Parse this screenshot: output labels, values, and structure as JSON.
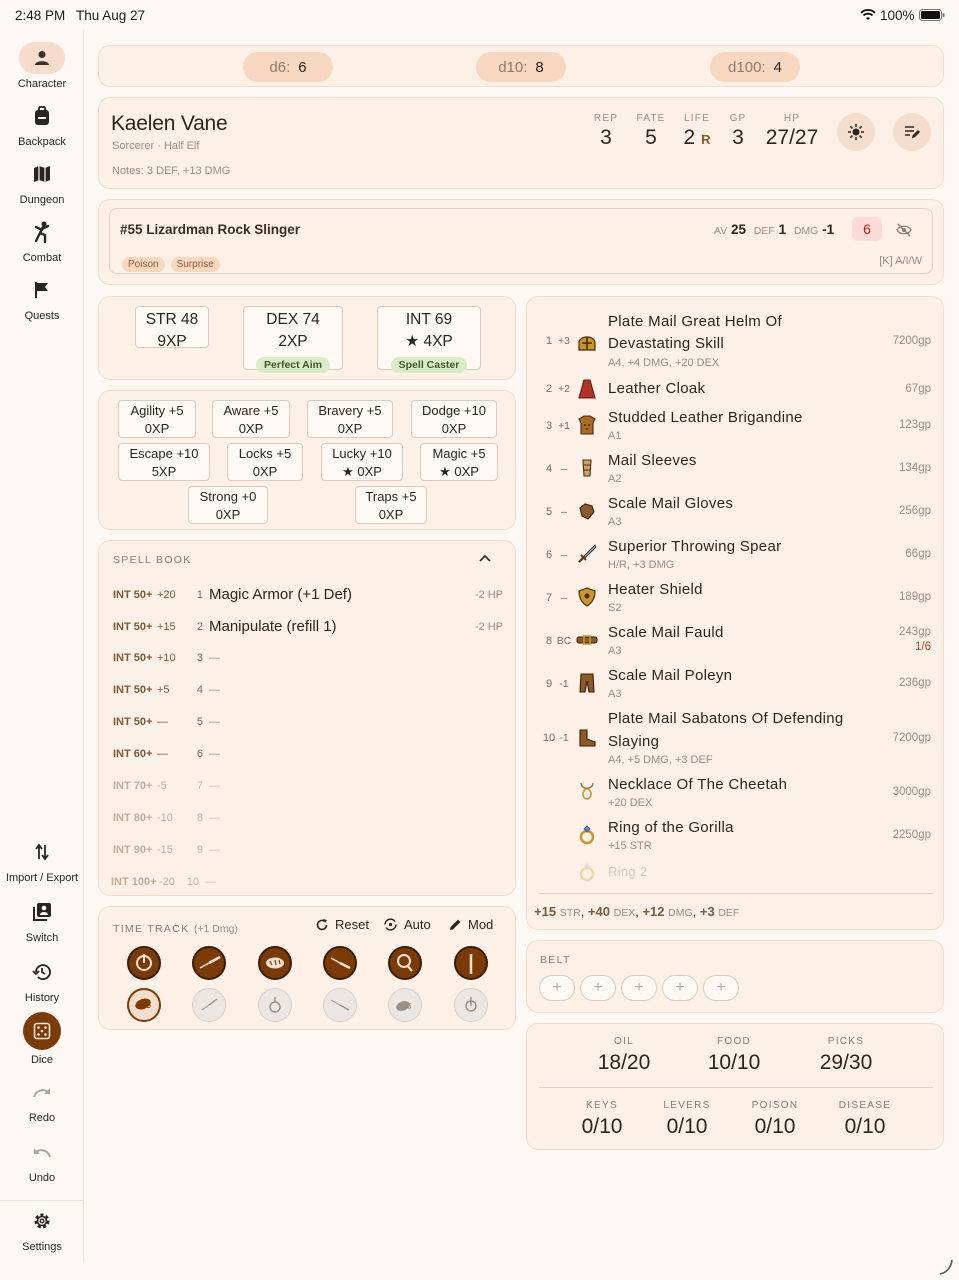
{
  "status": {
    "time": "2:48 PM",
    "date": "Thu Aug 27",
    "battery": "100%"
  },
  "nav": {
    "top": [
      {
        "label": "Character",
        "icon": "person-icon"
      },
      {
        "label": "Backpack",
        "icon": "backpack-icon"
      },
      {
        "label": "Dungeon",
        "icon": "map-icon"
      },
      {
        "label": "Combat",
        "icon": "kick-icon"
      },
      {
        "label": "Quests",
        "icon": "flag-icon"
      }
    ],
    "bottom": [
      {
        "label": "Import / Export",
        "icon": "swap-vertical-icon"
      },
      {
        "label": "Switch",
        "icon": "switch-account-icon"
      },
      {
        "label": "History",
        "icon": "history-icon"
      },
      {
        "label": "Dice",
        "icon": "dice-icon"
      },
      {
        "label": "Redo",
        "icon": "redo-icon"
      },
      {
        "label": "Undo",
        "icon": "undo-icon"
      },
      {
        "label": "Settings",
        "icon": "gear-icon"
      }
    ]
  },
  "dice": [
    {
      "label": "d6:",
      "value": "6"
    },
    {
      "label": "d10:",
      "value": "8"
    },
    {
      "label": "d100:",
      "value": "4"
    }
  ],
  "character": {
    "name": "Kaelen Vane",
    "subtitle": "Sorcerer · Half Elf",
    "notes": "Notes: 3 DEF, +13 DMG",
    "stats": [
      {
        "label": "REP",
        "value": "3"
      },
      {
        "label": "FATE",
        "value": "5"
      },
      {
        "label": "LIFE",
        "value": "2",
        "suffix": "R"
      },
      {
        "label": "GP",
        "value": "3"
      },
      {
        "label": "HP",
        "value": "27/27"
      }
    ]
  },
  "monster": {
    "title": "#55 Lizardman Rock Slinger",
    "av_label": "AV",
    "av": "25",
    "def_label": "DEF",
    "def": "1",
    "dmg_label": "DMG",
    "dmg": "-1",
    "hp": "6",
    "tags": [
      "Poison",
      "Surprise"
    ],
    "keys": "[K] A/I/W"
  },
  "attributes": [
    {
      "name": "STR 48",
      "xp": "9XP",
      "badge": ""
    },
    {
      "name": "DEX 74",
      "xp": "2XP",
      "badge": "Perfect Aim"
    },
    {
      "name": "INT 69",
      "xp": "★ 4XP",
      "badge": "Spell Caster"
    }
  ],
  "skills": [
    {
      "name": "Agility +5",
      "xp": "0XP"
    },
    {
      "name": "Aware +5",
      "xp": "0XP"
    },
    {
      "name": "Bravery +5",
      "xp": "0XP"
    },
    {
      "name": "Dodge +10",
      "xp": "0XP"
    },
    {
      "name": "Escape +10",
      "xp": "5XP"
    },
    {
      "name": "Locks +5",
      "xp": "0XP"
    },
    {
      "name": "Lucky +10",
      "xp": "★ 0XP"
    },
    {
      "name": "Magic +5",
      "xp": "★ 0XP"
    },
    {
      "name": "Strong +0",
      "xp": "0XP"
    },
    {
      "name": "Traps +5",
      "xp": "0XP"
    }
  ],
  "spellbook": {
    "title": "SPELL BOOK",
    "spells": [
      {
        "req": "INT 50+",
        "bonus": "+20",
        "num": "1",
        "name": "Magic Armor (+1 Def)",
        "cost": "-2 HP"
      },
      {
        "req": "INT 50+",
        "bonus": "+15",
        "num": "2",
        "name": "Manipulate (refill 1)",
        "cost": "-2 HP"
      },
      {
        "req": "INT 50+",
        "bonus": "+10",
        "num": "3",
        "name": "—",
        "cost": ""
      },
      {
        "req": "INT 50+",
        "bonus": "+5",
        "num": "4",
        "name": "—",
        "cost": ""
      },
      {
        "req": "INT 50+",
        "bonus": "—",
        "num": "5",
        "name": "—",
        "cost": ""
      },
      {
        "req": "INT 60+",
        "bonus": "—",
        "num": "6",
        "name": "—",
        "cost": ""
      },
      {
        "req": "INT 70+",
        "bonus": "-5",
        "num": "7",
        "name": "—",
        "cost": ""
      },
      {
        "req": "INT 80+",
        "bonus": "-10",
        "num": "8",
        "name": "—",
        "cost": ""
      },
      {
        "req": "INT 90+",
        "bonus": "-15",
        "num": "9",
        "name": "—",
        "cost": ""
      },
      {
        "req": "INT 100+",
        "bonus": "-20",
        "num": "10",
        "name": "—",
        "cost": ""
      }
    ]
  },
  "timetrack": {
    "title": "TIME TRACK",
    "subtitle": "(+1 Dmg)",
    "reset": "Reset",
    "auto": "Auto",
    "mod": "Mod"
  },
  "equipment": [
    {
      "n": "1",
      "b": "+3",
      "icon": "helmet-icon",
      "name": "Plate Mail Great Helm Of",
      "name2": "Devastating Skill",
      "sub": "A4, +4 DMG, +20 DEX",
      "gp": "7200gp",
      "gp2": ""
    },
    {
      "n": "2",
      "b": "+2",
      "icon": "cloak-icon",
      "name": "Leather Cloak",
      "name2": "",
      "sub": "",
      "gp": "67gp",
      "gp2": ""
    },
    {
      "n": "3",
      "b": "+1",
      "icon": "armor-icon",
      "name": "Studded Leather Brigandine",
      "name2": "",
      "sub": "A1",
      "gp": "123gp",
      "gp2": ""
    },
    {
      "n": "4",
      "b": "–",
      "icon": "bracer-icon",
      "name": "Mail Sleeves",
      "name2": "",
      "sub": "A2",
      "gp": "134gp",
      "gp2": ""
    },
    {
      "n": "5",
      "b": "–",
      "icon": "gauntlet-icon",
      "name": "Scale Mail Gloves",
      "name2": "",
      "sub": "A3",
      "gp": "256gp",
      "gp2": ""
    },
    {
      "n": "6",
      "b": "–",
      "icon": "sword-icon",
      "name": "Superior Throwing Spear",
      "name2": "",
      "sub": "H/R, +3 DMG",
      "gp": "66gp",
      "gp2": ""
    },
    {
      "n": "7",
      "b": "–",
      "icon": "shield-icon",
      "name": "Heater Shield",
      "name2": "",
      "sub": "S2",
      "gp": "189gp",
      "gp2": ""
    },
    {
      "n": "8",
      "b": "BC",
      "icon": "belt-icon",
      "name": "Scale Mail Fauld",
      "name2": "",
      "sub": "A3",
      "gp": "243gp",
      "gp2": "1/6"
    },
    {
      "n": "9",
      "b": "-1",
      "icon": "pants-icon",
      "name": "Scale Mail Poleyn",
      "name2": "",
      "sub": "A3",
      "gp": "236gp",
      "gp2": ""
    },
    {
      "n": "10",
      "b": "-1",
      "icon": "boot-icon",
      "name": "Plate Mail Sabatons Of Defending",
      "name2": "Slaying",
      "sub": "A4, +5 DMG, +3 DEF",
      "gp": "7200gp",
      "gp2": ""
    },
    {
      "n": "",
      "b": "",
      "icon": "necklace-icon",
      "name": "Necklace Of The Cheetah",
      "name2": "",
      "sub": "+20 DEX",
      "gp": "3000gp",
      "gp2": ""
    },
    {
      "n": "",
      "b": "",
      "icon": "ring-icon",
      "name": "Ring of the Gorilla",
      "name2": "",
      "sub": "+15 STR",
      "gp": "2250gp",
      "gp2": ""
    },
    {
      "n": "",
      "b": "",
      "icon": "ring-empty-icon",
      "name": "Ring 2",
      "name2": "",
      "sub": "",
      "gp": "",
      "gp2": ""
    }
  ],
  "equipment_totals": [
    {
      "v": "+15",
      "k": "STR"
    },
    {
      "v": "+40",
      "k": "DEX"
    },
    {
      "v": "+12",
      "k": "DMG"
    },
    {
      "v": "+3",
      "k": "DEF"
    }
  ],
  "belt": {
    "title": "BELT",
    "slot": "+"
  },
  "resources": {
    "top": [
      {
        "label": "OIL",
        "value": "18/20"
      },
      {
        "label": "FOOD",
        "value": "10/10"
      },
      {
        "label": "PICKS",
        "value": "29/30"
      }
    ],
    "bottom": [
      {
        "label": "KEYS",
        "value": "0/10"
      },
      {
        "label": "LEVERS",
        "value": "0/10"
      },
      {
        "label": "POISON",
        "value": "0/10"
      },
      {
        "label": "DISEASE",
        "value": "0/10"
      }
    ]
  },
  "colors": {
    "accent": "#7a3b08",
    "surface": "#fdf0e6",
    "pill": "#f7d7bf",
    "badge": "#d9ecc6"
  }
}
